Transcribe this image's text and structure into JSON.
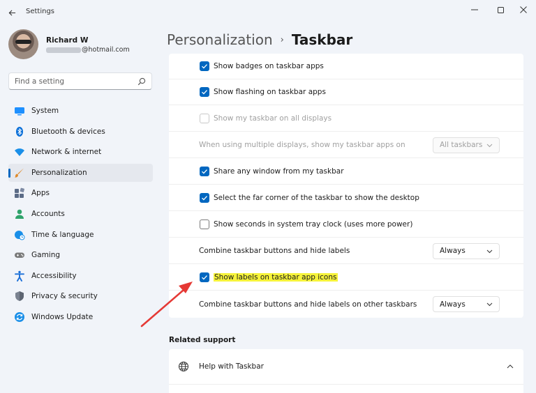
{
  "window": {
    "title": "Settings",
    "back_icon": "back-arrow-icon",
    "controls": [
      "minimize-icon",
      "maximize-icon",
      "close-icon"
    ]
  },
  "profile": {
    "name": "Richard W",
    "email_domain": "@hotmail.com"
  },
  "search": {
    "placeholder": "Find a setting",
    "icon": "search-icon"
  },
  "sidebar": {
    "items": [
      {
        "label": "System",
        "icon": "system-icon",
        "color": "#1e90ff",
        "active": false
      },
      {
        "label": "Bluetooth & devices",
        "icon": "bluetooth-icon",
        "color": "#0a6fd8",
        "active": false
      },
      {
        "label": "Network & internet",
        "icon": "wifi-icon",
        "color": "#1a8fe8",
        "active": false
      },
      {
        "label": "Personalization",
        "icon": "brush-icon",
        "color": "#e08a2a",
        "active": true
      },
      {
        "label": "Apps",
        "icon": "apps-icon",
        "color": "#5b6b86",
        "active": false
      },
      {
        "label": "Accounts",
        "icon": "accounts-icon",
        "color": "#2fa36b",
        "active": false
      },
      {
        "label": "Time & language",
        "icon": "globe-clock-icon",
        "color": "#1a8fe8",
        "active": false
      },
      {
        "label": "Gaming",
        "icon": "gamepad-icon",
        "color": "#7a7a7a",
        "active": false
      },
      {
        "label": "Accessibility",
        "icon": "accessibility-icon",
        "color": "#1a6fd8",
        "active": false
      },
      {
        "label": "Privacy & security",
        "icon": "shield-icon",
        "color": "#7a8290",
        "active": false
      },
      {
        "label": "Windows Update",
        "icon": "update-icon",
        "color": "#1a8fe8",
        "active": false
      }
    ]
  },
  "breadcrumb": {
    "parent": "Personalization",
    "separator": "›",
    "current": "Taskbar"
  },
  "settings": {
    "rows": [
      {
        "type": "checkbox",
        "label": "Show badges on taskbar apps",
        "checked": true,
        "disabled": false
      },
      {
        "type": "checkbox",
        "label": "Show flashing on taskbar apps",
        "checked": true,
        "disabled": false
      },
      {
        "type": "checkbox",
        "label": "Show my taskbar on all displays",
        "checked": false,
        "disabled": true
      },
      {
        "type": "dropdown",
        "label": "When using multiple displays, show my taskbar apps on",
        "value": "All taskbars",
        "disabled": true
      },
      {
        "type": "checkbox",
        "label": "Share any window from my taskbar",
        "checked": true,
        "disabled": false
      },
      {
        "type": "checkbox",
        "label": "Select the far corner of the taskbar to show the desktop",
        "checked": true,
        "disabled": false
      },
      {
        "type": "checkbox",
        "label": "Show seconds in system tray clock (uses more power)",
        "checked": false,
        "disabled": false
      },
      {
        "type": "dropdown",
        "label": "Combine taskbar buttons and hide labels",
        "value": "Always",
        "disabled": false
      },
      {
        "type": "checkbox",
        "label": "Show labels on taskbar app icons",
        "checked": true,
        "disabled": false,
        "highlighted": true
      },
      {
        "type": "dropdown",
        "label": "Combine taskbar buttons and hide labels on other taskbars",
        "value": "Always",
        "disabled": false
      }
    ]
  },
  "related": {
    "heading": "Related support",
    "help_label": "Help with Taskbar",
    "help_icon": "globe-icon"
  },
  "colors": {
    "accent": "#0067c0",
    "highlight": "#f6f33a",
    "annotation_arrow": "#e53935"
  }
}
